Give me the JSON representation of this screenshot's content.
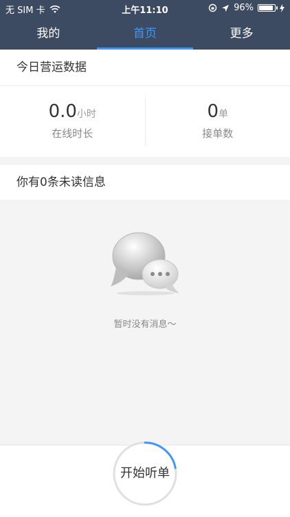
{
  "status_bar": {
    "carrier": "无 SIM 卡",
    "time": "上午11:10",
    "battery": "96%"
  },
  "tabs": [
    {
      "label": "我的",
      "active": false
    },
    {
      "label": "首页",
      "active": true
    },
    {
      "label": "更多",
      "active": false
    }
  ],
  "ops": {
    "title": "今日营运数据",
    "stats": [
      {
        "value": "0.0",
        "unit": "小时",
        "label": "在线时长"
      },
      {
        "value": "0",
        "unit": "单",
        "label": "接单数"
      }
    ]
  },
  "messages": {
    "title": "你有0条未读信息",
    "empty_text": "暂时没有消息～"
  },
  "start_button": {
    "label": "开始听单",
    "progress": 0.22
  },
  "colors": {
    "header": "#3d4b62",
    "accent": "#3e97ff"
  }
}
